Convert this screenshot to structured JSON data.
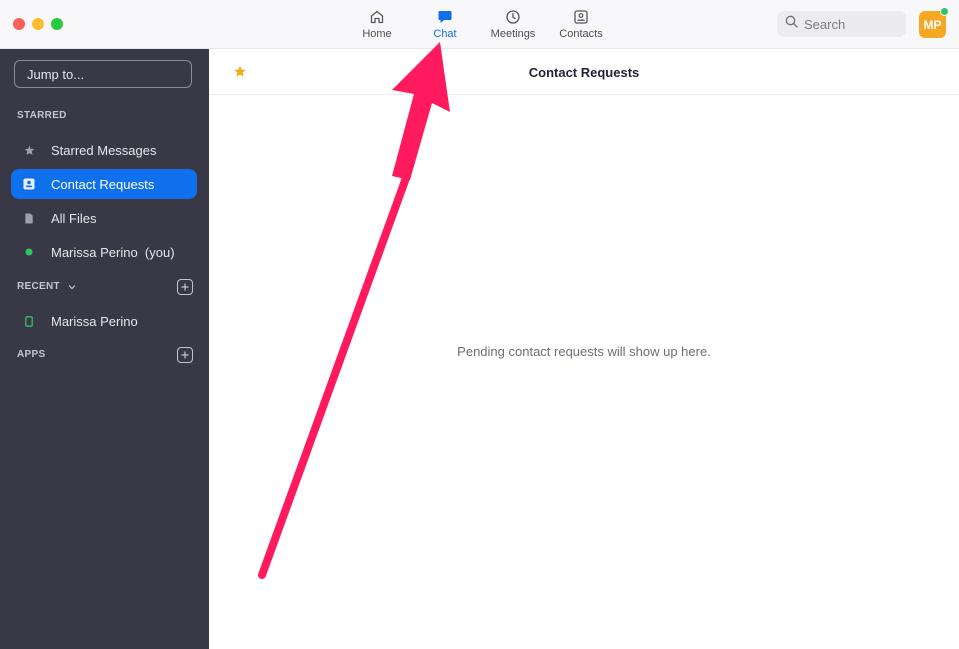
{
  "window": {
    "traffic_lights": [
      "close",
      "minimize",
      "zoom"
    ]
  },
  "nav": {
    "items": [
      {
        "label": "Home",
        "icon": "home-icon",
        "active": false
      },
      {
        "label": "Chat",
        "icon": "chat-bubble-icon",
        "active": true
      },
      {
        "label": "Meetings",
        "icon": "clock-icon",
        "active": false
      },
      {
        "label": "Contacts",
        "icon": "contact-card-icon",
        "active": false
      }
    ]
  },
  "search": {
    "placeholder": "Search"
  },
  "user": {
    "initials": "MP",
    "status": "online"
  },
  "sidebar": {
    "jump_placeholder": "Jump to...",
    "starred_title": "STARRED",
    "starred_items": [
      {
        "label": "Starred Messages",
        "icon": "star-icon"
      },
      {
        "label": "Contact Requests",
        "icon": "contact-card-icon",
        "active": true
      },
      {
        "label": "All Files",
        "icon": "file-icon"
      },
      {
        "label": "Marissa Perino  (you)",
        "icon": "online-dot-icon"
      }
    ],
    "recent_title": "RECENT",
    "recent_items": [
      {
        "label": "Marissa Perino",
        "icon": "phone-icon"
      }
    ],
    "apps_title": "APPS"
  },
  "main": {
    "title": "Contact Requests",
    "empty_message": "Pending contact requests will show up here."
  },
  "colors": {
    "accent": "#0e71eb",
    "sidebar_bg": "#383847",
    "avatar": "#f7a823",
    "online": "#2fc463",
    "annotation_arrow": "#ff1a5e"
  }
}
